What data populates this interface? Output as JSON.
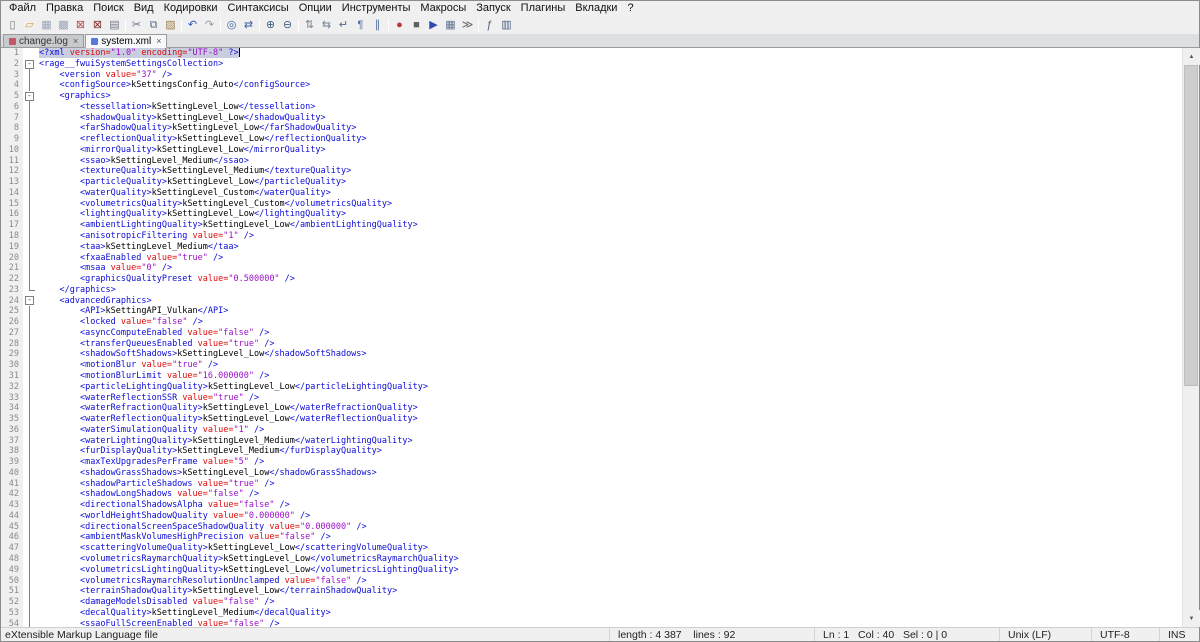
{
  "app": {
    "name": "Notepad++"
  },
  "menu": {
    "items": [
      {
        "id": "file",
        "label": "Файл"
      },
      {
        "id": "edit",
        "label": "Правка"
      },
      {
        "id": "search",
        "label": "Поиск"
      },
      {
        "id": "view",
        "label": "Вид"
      },
      {
        "id": "encoding",
        "label": "Кодировки"
      },
      {
        "id": "language",
        "label": "Синтаксисы"
      },
      {
        "id": "settings",
        "label": "Опции"
      },
      {
        "id": "tools",
        "label": "Инструменты"
      },
      {
        "id": "macro",
        "label": "Макросы"
      },
      {
        "id": "run",
        "label": "Запуск"
      },
      {
        "id": "plugins",
        "label": "Плагины"
      },
      {
        "id": "tabs",
        "label": "Вкладки"
      },
      {
        "id": "help",
        "label": "?"
      }
    ]
  },
  "toolbar": {
    "icons": [
      {
        "id": "new-file",
        "glyph": "▯",
        "color": "#777777"
      },
      {
        "id": "open-folder",
        "glyph": "▱",
        "color": "#d79e3c"
      },
      {
        "id": "save",
        "glyph": "▦",
        "color": "#9aa4b8"
      },
      {
        "id": "save-all",
        "glyph": "▩",
        "color": "#9aa4b8"
      },
      {
        "id": "close",
        "glyph": "⊠",
        "color": "#b05050"
      },
      {
        "id": "close-all",
        "glyph": "⊠",
        "color": "#803030"
      },
      {
        "id": "print",
        "glyph": "▤",
        "color": "#707888"
      },
      {
        "sep": true
      },
      {
        "id": "cut",
        "glyph": "✂",
        "color": "#607090"
      },
      {
        "id": "copy",
        "glyph": "⧉",
        "color": "#607090"
      },
      {
        "id": "paste",
        "glyph": "▨",
        "color": "#a08050"
      },
      {
        "sep": true
      },
      {
        "id": "undo",
        "glyph": "↶",
        "color": "#3050c0"
      },
      {
        "id": "redo",
        "glyph": "↷",
        "color": "#9098a8"
      },
      {
        "sep": true
      },
      {
        "id": "find",
        "glyph": "◎",
        "color": "#4060a0"
      },
      {
        "id": "replace",
        "glyph": "⇄",
        "color": "#4060a0"
      },
      {
        "sep": true
      },
      {
        "id": "zoom-in",
        "glyph": "⊕",
        "color": "#406080"
      },
      {
        "id": "zoom-out",
        "glyph": "⊖",
        "color": "#406080"
      },
      {
        "sep": true
      },
      {
        "id": "sync-vertical",
        "glyph": "⇅",
        "color": "#708090"
      },
      {
        "id": "sync-horizontal",
        "glyph": "⇆",
        "color": "#708090"
      },
      {
        "id": "word-wrap",
        "glyph": "↵",
        "color": "#506880"
      },
      {
        "id": "show-all-characters",
        "glyph": "¶",
        "color": "#5070a0"
      },
      {
        "id": "indent-guide",
        "glyph": "∥",
        "color": "#5070a0"
      },
      {
        "sep": true
      },
      {
        "id": "macro-record",
        "glyph": "●",
        "color": "#c03030"
      },
      {
        "id": "macro-stop",
        "glyph": "■",
        "color": "#606060"
      },
      {
        "id": "macro-play",
        "glyph": "▶",
        "color": "#3048b0"
      },
      {
        "id": "macro-save",
        "glyph": "▦",
        "color": "#607090"
      },
      {
        "id": "macro-run-multiple",
        "glyph": "≫",
        "color": "#606060"
      },
      {
        "sep": true
      },
      {
        "id": "function-list",
        "glyph": "ƒ",
        "color": "#506080"
      },
      {
        "id": "document-map",
        "glyph": "▥",
        "color": "#506080"
      }
    ]
  },
  "tabs": {
    "close_glyph": "×",
    "items": [
      {
        "id": "change-log",
        "label": "change.log",
        "active": false,
        "indicator": "unsaved-indicator",
        "indicator_color": "#c4566b"
      },
      {
        "id": "system-xml",
        "label": "system.xml",
        "active": true,
        "indicator": "saved-indicator",
        "indicator_color": "#5b79d8"
      }
    ]
  },
  "editor": {
    "declaration": {
      "version": "1.0",
      "encoding": "UTF-8"
    },
    "lines": [
      {
        "k": "decl",
        "ver": "1.0",
        "enc": "UTF-8",
        "f": "",
        "d": 0,
        "cur": true
      },
      {
        "k": "open",
        "n": "rage__fwuiSystemSettingsCollection",
        "f": "o",
        "d": 0
      },
      {
        "k": "attr",
        "n": "version",
        "v": "37",
        "f": "l",
        "d": 1
      },
      {
        "k": "text",
        "n": "configSource",
        "v": "kSettingsConfig_Auto",
        "f": "l",
        "d": 1
      },
      {
        "k": "open",
        "n": "graphics",
        "f": "o",
        "d": 1
      },
      {
        "k": "text",
        "n": "tessellation",
        "v": "kSettingLevel_Low",
        "f": "l",
        "d": 2
      },
      {
        "k": "text",
        "n": "shadowQuality",
        "v": "kSettingLevel_Low",
        "f": "l",
        "d": 2
      },
      {
        "k": "text",
        "n": "farShadowQuality",
        "v": "kSettingLevel_Low",
        "f": "l",
        "d": 2
      },
      {
        "k": "text",
        "n": "reflectionQuality",
        "v": "kSettingLevel_Low",
        "f": "l",
        "d": 2
      },
      {
        "k": "text",
        "n": "mirrorQuality",
        "v": "kSettingLevel_Low",
        "f": "l",
        "d": 2
      },
      {
        "k": "text",
        "n": "ssao",
        "v": "kSettingLevel_Medium",
        "f": "l",
        "d": 2
      },
      {
        "k": "text",
        "n": "textureQuality",
        "v": "kSettingLevel_Medium",
        "f": "l",
        "d": 2
      },
      {
        "k": "text",
        "n": "particleQuality",
        "v": "kSettingLevel_Low",
        "f": "l",
        "d": 2
      },
      {
        "k": "text",
        "n": "waterQuality",
        "v": "kSettingLevel_Custom",
        "f": "l",
        "d": 2
      },
      {
        "k": "text",
        "n": "volumetricsQuality",
        "v": "kSettingLevel_Custom",
        "f": "l",
        "d": 2
      },
      {
        "k": "text",
        "n": "lightingQuality",
        "v": "kSettingLevel_Low",
        "f": "l",
        "d": 2
      },
      {
        "k": "text",
        "n": "ambientLightingQuality",
        "v": "kSettingLevel_Low",
        "f": "l",
        "d": 2
      },
      {
        "k": "attr",
        "n": "anisotropicFiltering",
        "v": "1",
        "f": "l",
        "d": 2
      },
      {
        "k": "text",
        "n": "taa",
        "v": "kSettingLevel_Medium",
        "f": "l",
        "d": 2
      },
      {
        "k": "attr",
        "n": "fxaaEnabled",
        "v": "true",
        "f": "l",
        "d": 2
      },
      {
        "k": "attr",
        "n": "msaa",
        "v": "0",
        "f": "l",
        "d": 2
      },
      {
        "k": "attr",
        "n": "graphicsQualityPreset",
        "v": "0.500000",
        "f": "l",
        "d": 2
      },
      {
        "k": "close",
        "n": "graphics",
        "f": "e",
        "d": 1
      },
      {
        "k": "open",
        "n": "advancedGraphics",
        "f": "o",
        "d": 1
      },
      {
        "k": "text",
        "n": "API",
        "v": "kSettingAPI_Vulkan",
        "f": "l",
        "d": 2
      },
      {
        "k": "attr",
        "n": "locked",
        "v": "false",
        "f": "l",
        "d": 2
      },
      {
        "k": "attr",
        "n": "asyncComputeEnabled",
        "v": "false",
        "f": "l",
        "d": 2
      },
      {
        "k": "attr",
        "n": "transferQueuesEnabled",
        "v": "true",
        "f": "l",
        "d": 2
      },
      {
        "k": "text",
        "n": "shadowSoftShadows",
        "v": "kSettingLevel_Low",
        "f": "l",
        "d": 2
      },
      {
        "k": "attr",
        "n": "motionBlur",
        "v": "true",
        "f": "l",
        "d": 2
      },
      {
        "k": "attr",
        "n": "motionBlurLimit",
        "v": "16.000000",
        "f": "l",
        "d": 2
      },
      {
        "k": "text",
        "n": "particleLightingQuality",
        "v": "kSettingLevel_Low",
        "f": "l",
        "d": 2
      },
      {
        "k": "attr",
        "n": "waterReflectionSSR",
        "v": "true",
        "f": "l",
        "d": 2
      },
      {
        "k": "text",
        "n": "waterRefractionQuality",
        "v": "kSettingLevel_Low",
        "f": "l",
        "d": 2
      },
      {
        "k": "text",
        "n": "waterReflectionQuality",
        "v": "kSettingLevel_Low",
        "f": "l",
        "d": 2
      },
      {
        "k": "attr",
        "n": "waterSimulationQuality",
        "v": "1",
        "f": "l",
        "d": 2
      },
      {
        "k": "text",
        "n": "waterLightingQuality",
        "v": "kSettingLevel_Medium",
        "f": "l",
        "d": 2
      },
      {
        "k": "text",
        "n": "furDisplayQuality",
        "v": "kSettingLevel_Medium",
        "f": "l",
        "d": 2
      },
      {
        "k": "attr",
        "n": "maxTexUpgradesPerFrame",
        "v": "5",
        "f": "l",
        "d": 2
      },
      {
        "k": "text",
        "n": "shadowGrassShadows",
        "v": "kSettingLevel_Low",
        "f": "l",
        "d": 2
      },
      {
        "k": "attr",
        "n": "shadowParticleShadows",
        "v": "true",
        "f": "l",
        "d": 2
      },
      {
        "k": "attr",
        "n": "shadowLongShadows",
        "v": "false",
        "f": "l",
        "d": 2
      },
      {
        "k": "attr",
        "n": "directionalShadowsAlpha",
        "v": "false",
        "f": "l",
        "d": 2
      },
      {
        "k": "attr",
        "n": "worldHeightShadowQuality",
        "v": "0.000000",
        "f": "l",
        "d": 2
      },
      {
        "k": "attr",
        "n": "directionalScreenSpaceShadowQuality",
        "v": "0.000000",
        "f": "l",
        "d": 2
      },
      {
        "k": "attr",
        "n": "ambientMaskVolumesHighPrecision",
        "v": "false",
        "f": "l",
        "d": 2
      },
      {
        "k": "text",
        "n": "scatteringVolumeQuality",
        "v": "kSettingLevel_Low",
        "f": "l",
        "d": 2
      },
      {
        "k": "text",
        "n": "volumetricsRaymarchQuality",
        "v": "kSettingLevel_Low",
        "f": "l",
        "d": 2
      },
      {
        "k": "text",
        "n": "volumetricsLightingQuality",
        "v": "kSettingLevel_Low",
        "f": "l",
        "d": 2
      },
      {
        "k": "attr",
        "n": "volumetricsRaymarchResolutionUnclamped",
        "v": "false",
        "f": "l",
        "d": 2
      },
      {
        "k": "text",
        "n": "terrainShadowQuality",
        "v": "kSettingLevel_Low",
        "f": "l",
        "d": 2
      },
      {
        "k": "attr",
        "n": "damageModelsDisabled",
        "v": "false",
        "f": "l",
        "d": 2
      },
      {
        "k": "text",
        "n": "decalQuality",
        "v": "kSettingLevel_Medium",
        "f": "l",
        "d": 2
      },
      {
        "k": "attr",
        "n": "ssaoFullScreenEnabled",
        "v": "false",
        "f": "l",
        "d": 2
      }
    ],
    "colors": {
      "tag": "#0b0bd6",
      "attribute": "#dc0a0a",
      "string": "#9a10c8",
      "text": "#000000",
      "current_line_bg": "#c9cde0"
    }
  },
  "statusbar": {
    "doctype": "eXtensible Markup Language file",
    "stats": "length : 4 387    lines : 92",
    "position": "Ln : 1   Col : 40   Sel : 0 | 0",
    "eol": "Unix (LF)",
    "encoding": "UTF-8",
    "typing_mode": "INS"
  }
}
